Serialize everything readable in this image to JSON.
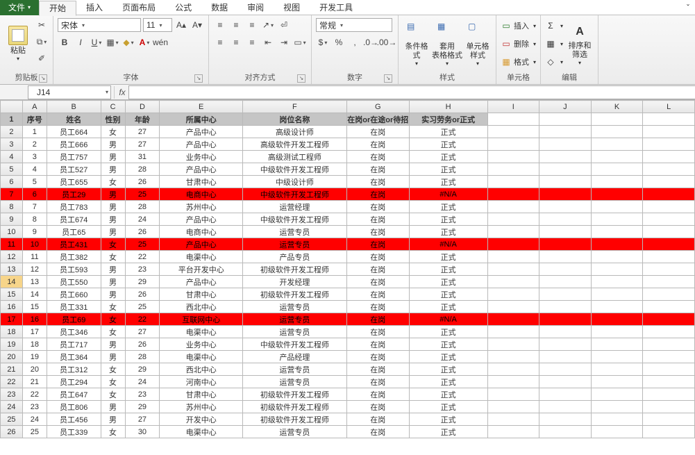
{
  "tabs": {
    "file": "文件",
    "home": "开始",
    "insert": "插入",
    "layout": "页面布局",
    "formula": "公式",
    "data": "数据",
    "review": "审阅",
    "view": "视图",
    "dev": "开发工具"
  },
  "ribbon": {
    "clipboard": "剪贴板",
    "paste": "粘贴",
    "font": {
      "label": "字体",
      "family": "宋体",
      "size": "11"
    },
    "align": "对齐方式",
    "number": {
      "label": "数字",
      "format": "常规"
    },
    "styles": {
      "label": "样式",
      "cond": "条件格式",
      "table": "套用\n表格格式",
      "cell": "单元格样式"
    },
    "cells": {
      "label": "单元格",
      "insert": "插入",
      "delete": "删除",
      "format": "格式"
    },
    "editing": {
      "label": "编辑",
      "sort": "排序和筛选"
    }
  },
  "namebox": "J14",
  "formula": "",
  "columns": [
    "A",
    "B",
    "C",
    "D",
    "E",
    "F",
    "G",
    "H",
    "I",
    "J",
    "K",
    "L"
  ],
  "header": [
    "序号",
    "姓名",
    "性别",
    "年龄",
    "所属中心",
    "岗位名称",
    "在岗or在途or待招",
    "实习劳务or正式"
  ],
  "rows": [
    {
      "n": 1,
      "c": [
        "1",
        "员工664",
        "女",
        "27",
        "产品中心",
        "高级设计师",
        "在岗",
        "正式"
      ]
    },
    {
      "n": 2,
      "c": [
        "2",
        "员工666",
        "男",
        "27",
        "产品中心",
        "高级软件开发工程师",
        "在岗",
        "正式"
      ]
    },
    {
      "n": 3,
      "c": [
        "3",
        "员工757",
        "男",
        "31",
        "业务中心",
        "高级测试工程师",
        "在岗",
        "正式"
      ]
    },
    {
      "n": 4,
      "c": [
        "4",
        "员工527",
        "男",
        "28",
        "产品中心",
        "中级软件开发工程师",
        "在岗",
        "正式"
      ]
    },
    {
      "n": 5,
      "c": [
        "5",
        "员工655",
        "女",
        "26",
        "甘肃中心",
        "中级设计师",
        "在岗",
        "正式"
      ]
    },
    {
      "n": 6,
      "c": [
        "6",
        "员工29",
        "男",
        "25",
        "电商中心",
        "中级软件开发工程师",
        "在岗",
        "#N/A"
      ],
      "red": true
    },
    {
      "n": 7,
      "c": [
        "7",
        "员工783",
        "男",
        "28",
        "苏州中心",
        "运营经理",
        "在岗",
        "正式"
      ]
    },
    {
      "n": 8,
      "c": [
        "8",
        "员工674",
        "男",
        "24",
        "产品中心",
        "中级软件开发工程师",
        "在岗",
        "正式"
      ]
    },
    {
      "n": 9,
      "c": [
        "9",
        "员工65",
        "男",
        "26",
        "电商中心",
        "运营专员",
        "在岗",
        "正式"
      ]
    },
    {
      "n": 10,
      "c": [
        "10",
        "员工431",
        "女",
        "25",
        "产品中心",
        "运营专员",
        "在岗",
        "#N/A"
      ],
      "red": true
    },
    {
      "n": 11,
      "c": [
        "11",
        "员工382",
        "女",
        "22",
        "电渠中心",
        "产品专员",
        "在岗",
        "正式"
      ]
    },
    {
      "n": 12,
      "c": [
        "12",
        "员工593",
        "男",
        "23",
        "平台开发中心",
        "初级软件开发工程师",
        "在岗",
        "正式"
      ]
    },
    {
      "n": 13,
      "c": [
        "13",
        "员工550",
        "男",
        "29",
        "产品中心",
        "开发经理",
        "在岗",
        "正式"
      ]
    },
    {
      "n": 14,
      "c": [
        "14",
        "员工660",
        "男",
        "26",
        "甘肃中心",
        "初级软件开发工程师",
        "在岗",
        "正式"
      ]
    },
    {
      "n": 15,
      "c": [
        "15",
        "员工331",
        "女",
        "25",
        "西北中心",
        "运营专员",
        "在岗",
        "正式"
      ]
    },
    {
      "n": 16,
      "c": [
        "16",
        "员工69",
        "女",
        "22",
        "互联网中心",
        "运营专员",
        "在岗",
        "#N/A"
      ],
      "red": true
    },
    {
      "n": 17,
      "c": [
        "17",
        "员工346",
        "女",
        "27",
        "电渠中心",
        "运营专员",
        "在岗",
        "正式"
      ]
    },
    {
      "n": 18,
      "c": [
        "18",
        "员工717",
        "男",
        "26",
        "业务中心",
        "中级软件开发工程师",
        "在岗",
        "正式"
      ]
    },
    {
      "n": 19,
      "c": [
        "19",
        "员工364",
        "男",
        "28",
        "电渠中心",
        "产品经理",
        "在岗",
        "正式"
      ]
    },
    {
      "n": 20,
      "c": [
        "20",
        "员工312",
        "女",
        "29",
        "西北中心",
        "运营专员",
        "在岗",
        "正式"
      ]
    },
    {
      "n": 21,
      "c": [
        "21",
        "员工294",
        "女",
        "24",
        "河南中心",
        "运营专员",
        "在岗",
        "正式"
      ]
    },
    {
      "n": 22,
      "c": [
        "22",
        "员工647",
        "女",
        "23",
        "甘肃中心",
        "初级软件开发工程师",
        "在岗",
        "正式"
      ]
    },
    {
      "n": 23,
      "c": [
        "23",
        "员工806",
        "男",
        "29",
        "苏州中心",
        "初级软件开发工程师",
        "在岗",
        "正式"
      ]
    },
    {
      "n": 24,
      "c": [
        "24",
        "员工456",
        "男",
        "27",
        "开发中心",
        "初级软件开发工程师",
        "在岗",
        "正式"
      ]
    },
    {
      "n": 25,
      "c": [
        "25",
        "员工339",
        "女",
        "30",
        "电渠中心",
        "运营专员",
        "在岗",
        "正式"
      ]
    }
  ],
  "highlightRow": 14
}
